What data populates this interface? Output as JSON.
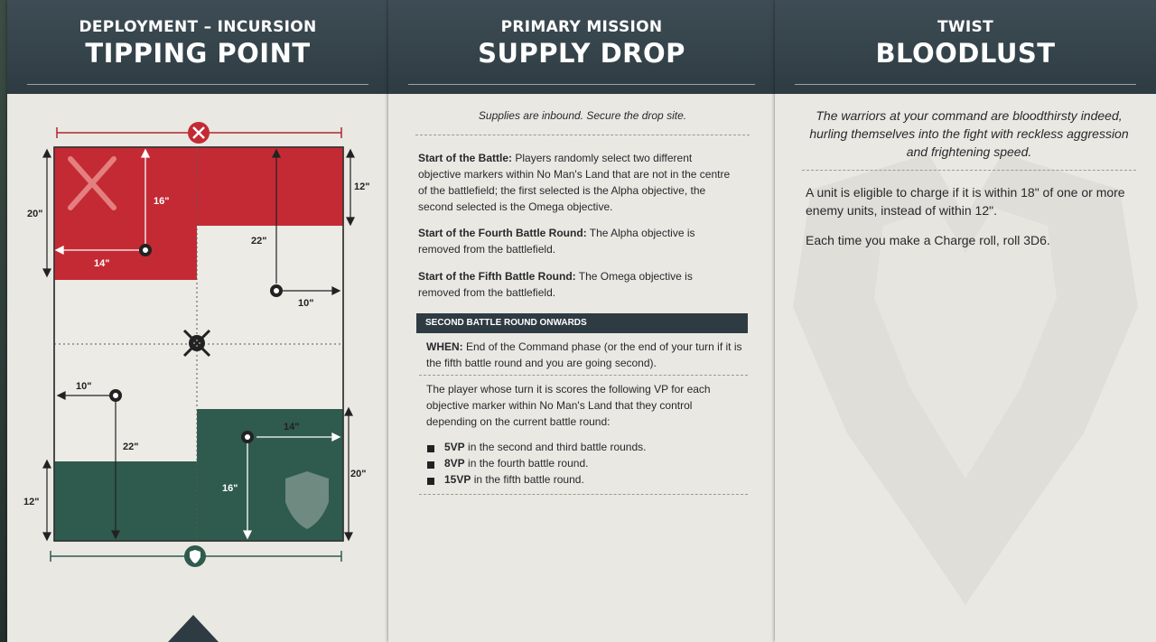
{
  "deployment": {
    "subtitle": "DEPLOYMENT – INCURSION",
    "title": "TIPPING POINT",
    "map": {
      "labels": [
        "20\"",
        "16\"",
        "12\"",
        "22\"",
        "14\"",
        "10\"",
        "10\"",
        "22\"",
        "14\"",
        "16\"",
        "12\"",
        "20\""
      ]
    }
  },
  "mission": {
    "subtitle": "PRIMARY MISSION",
    "title": "SUPPLY DROP",
    "flavor": "Supplies are inbound. Secure the drop site.",
    "rules": [
      {
        "label": "Start of the Battle:",
        "text": " Players randomly select two different objective markers within No Man's Land that are not in the centre of the battlefield; the first selected is the Alpha objective, the second selected is the Omega objective."
      },
      {
        "label": "Start of the Fourth Battle Round:",
        "text": " The Alpha objective is removed from the battlefield."
      },
      {
        "label": "Start of the Fifth Battle Round:",
        "text": " The Omega objective is removed from the battlefield."
      }
    ],
    "bar_label": "SECOND BATTLE ROUND ONWARDS",
    "when_label": "WHEN:",
    "when_text": " End of the Command phase (or the end of your turn if it is the fifth battle round and you are going second).",
    "score_text": "The player whose turn it is scores the following VP for each objective marker within No Man's Land that they control depending on the current battle round:",
    "bullets": [
      {
        "vp": "5VP",
        "text": " in the second and third battle rounds."
      },
      {
        "vp": "8VP",
        "text": " in the fourth battle round."
      },
      {
        "vp": "15VP",
        "text": " in the fifth battle round."
      }
    ]
  },
  "twist": {
    "subtitle": "TWIST",
    "title": "BLOODLUST",
    "flavor": "The warriors at your command are bloodthirsty indeed, hurling themselves into the fight with reckless aggression and frightening speed.",
    "para1": "A unit is eligible to charge if it is within 18\" of one or more enemy units, instead of within 12\".",
    "para2": "Each time you make a Charge roll, roll 3D6."
  },
  "colors": {
    "header": "#2e3b42",
    "card": "#e9e8e3",
    "red_zone": "#c42a34",
    "green_zone": "#2f5a4e"
  }
}
